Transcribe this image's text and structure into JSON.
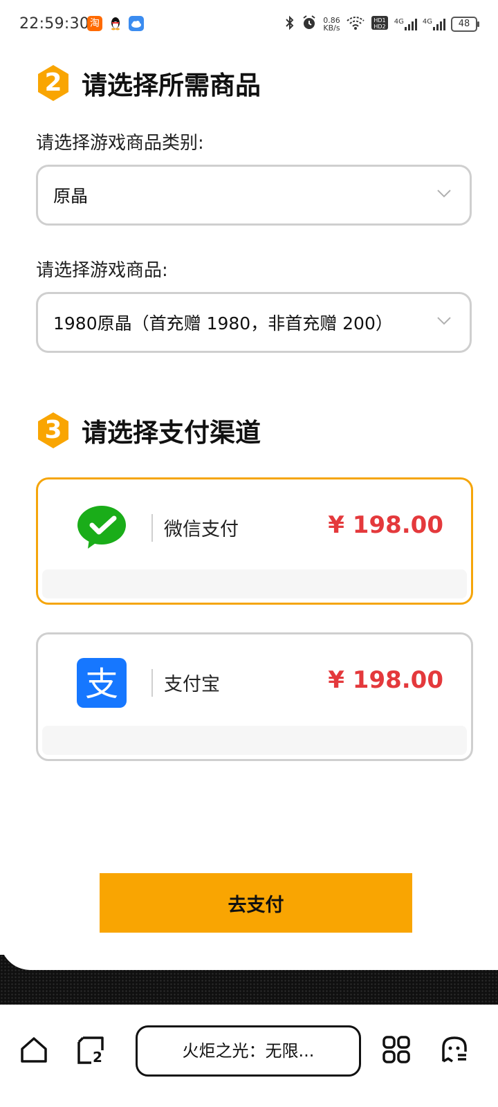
{
  "status_bar": {
    "time": "22:59:30",
    "app_icons": [
      "taobao-icon",
      "qq-icon",
      "cloud-icon"
    ],
    "net_speed_value": "0.86",
    "net_speed_unit": "KB/s",
    "signal_label_1": "4G",
    "signal_label_2": "4G",
    "battery": "48"
  },
  "section2": {
    "number": "2",
    "title": "请选择所需商品",
    "category_label": "请选择游戏商品类别:",
    "category_value": "原晶",
    "product_label": "请选择游戏商品:",
    "product_value": "1980原晶（首充赠 1980，非首充赠 200）"
  },
  "section3": {
    "number": "3",
    "title": "请选择支付渠道",
    "methods": [
      {
        "name": "微信支付",
        "price": "¥ 198.00",
        "icon": "wechat-pay-icon",
        "selected": true
      },
      {
        "name": "支付宝",
        "price": "¥ 198.00",
        "icon": "alipay-icon",
        "selected": false
      }
    ]
  },
  "pay_button_label": "去支付",
  "browser_bar": {
    "tab_count": "2",
    "tab_title": "火炬之光：无限..."
  },
  "colors": {
    "accent": "#f9a502",
    "price_red": "#e4393c",
    "wechat_green": "#1aad19",
    "alipay_blue": "#1677ff"
  }
}
